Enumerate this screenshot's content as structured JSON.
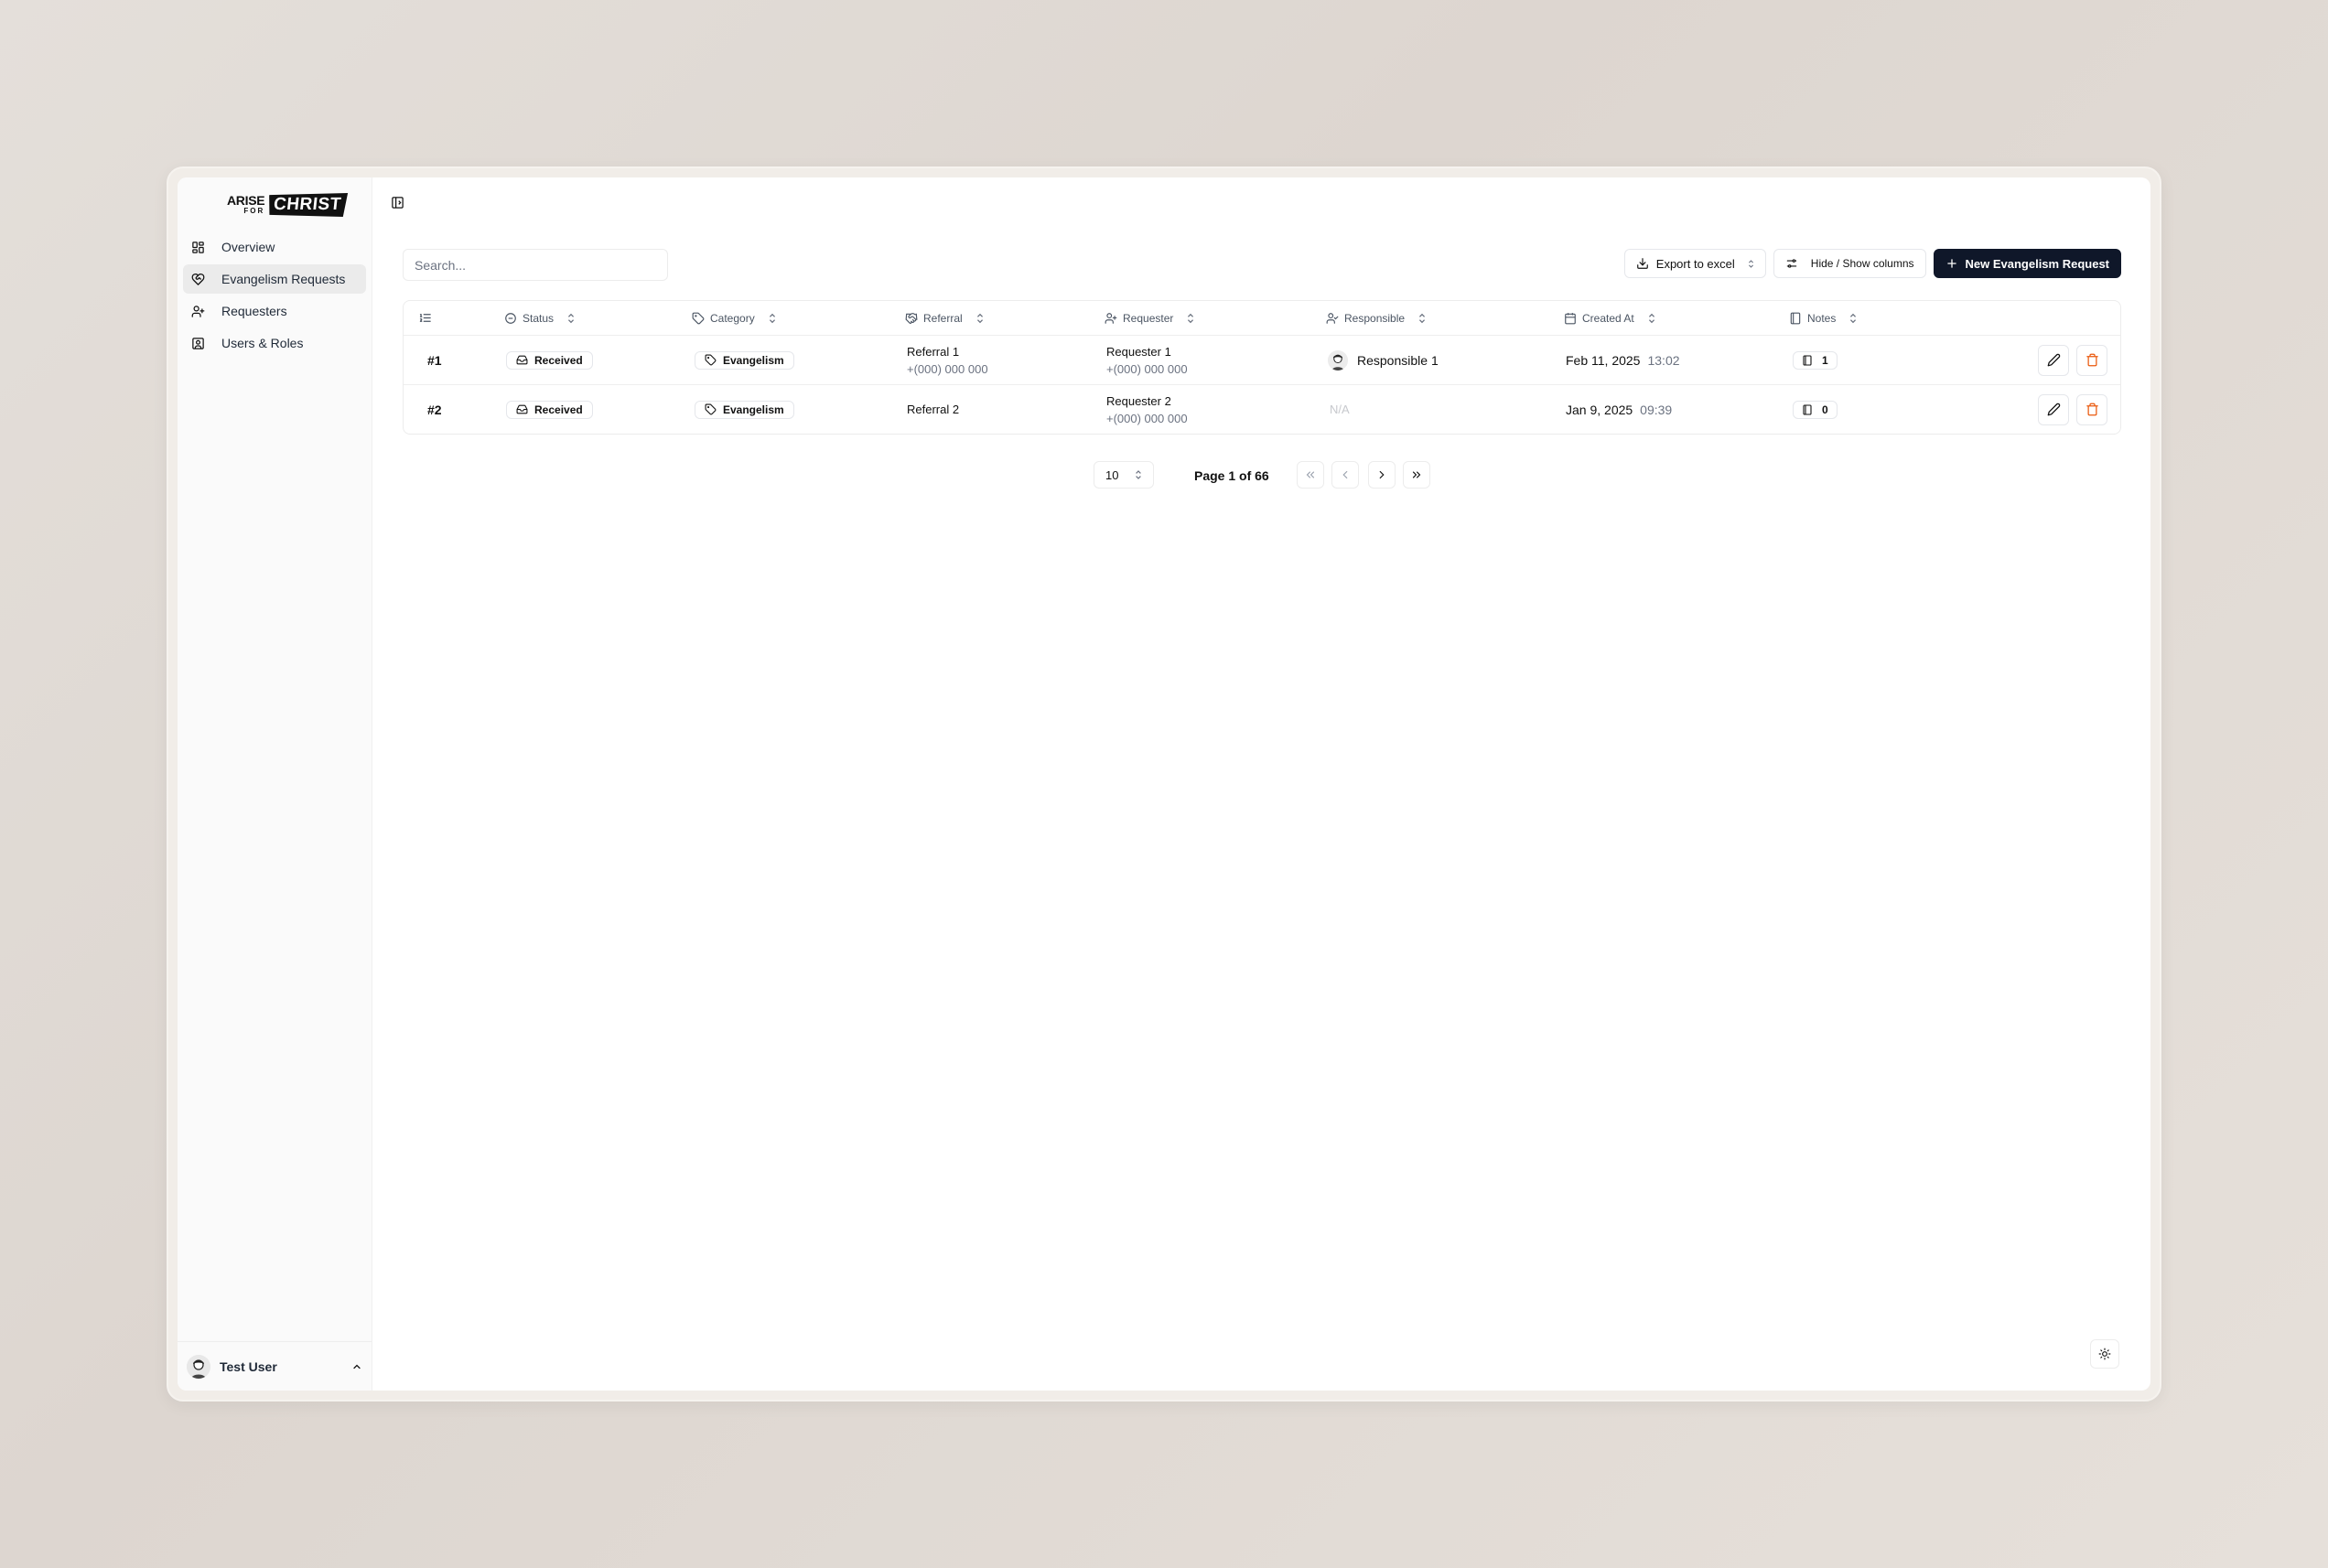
{
  "brand": {
    "line1": "ARISE",
    "line2": "FOR",
    "line3": "CHRIST"
  },
  "sidebar": {
    "items": [
      {
        "label": "Overview",
        "icon": "grid-icon"
      },
      {
        "label": "Evangelism Requests",
        "icon": "heart-handshake-icon",
        "active": true
      },
      {
        "label": "Requesters",
        "icon": "user-plus-icon"
      },
      {
        "label": "Users & Roles",
        "icon": "contact-icon"
      }
    ],
    "user": {
      "name": "Test User"
    }
  },
  "search": {
    "placeholder": "Search..."
  },
  "toolbar": {
    "export_label": "Export to excel",
    "columns_label": "Hide / Show columns",
    "new_label": "New Evangelism Request"
  },
  "table": {
    "headers": {
      "status": "Status",
      "category": "Category",
      "referral": "Referral",
      "requester": "Requester",
      "responsible": "Responsible",
      "created_at": "Created At",
      "notes": "Notes"
    },
    "rows": [
      {
        "id": "#1",
        "status": "Received",
        "category": "Evangelism",
        "referral_name": "Referral 1",
        "referral_phone": "+(000) 000 000",
        "requester_name": "Requester 1",
        "requester_phone": "+(000) 000 000",
        "responsible": "Responsible 1",
        "created_date": "Feb 11, 2025",
        "created_time": "13:02",
        "notes": "1"
      },
      {
        "id": "#2",
        "status": "Received",
        "category": "Evangelism",
        "referral_name": "Referral 2",
        "referral_phone": "",
        "requester_name": "Requester 2",
        "requester_phone": "+(000) 000 000",
        "responsible": "N/A",
        "created_date": "Jan 9, 2025",
        "created_time": "09:39",
        "notes": "0"
      }
    ]
  },
  "pagination": {
    "page_size": "10",
    "page_info": "Page 1 of 66"
  },
  "colors": {
    "primary": "#0f1729",
    "delete": "#ea580c",
    "active_nav": "#ebebeb"
  }
}
